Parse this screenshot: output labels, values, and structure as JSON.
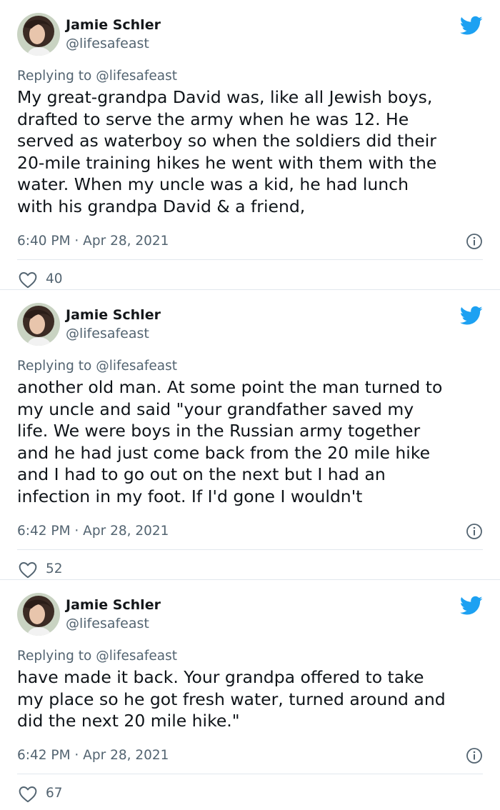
{
  "colors": {
    "brand": "#1da1f2",
    "secondary_text": "#536471",
    "divider": "#e1e8ed"
  },
  "tweets": [
    {
      "name": "Jamie Schler",
      "handle": "@lifesafeast",
      "replying_prefix": "Replying to ",
      "replying_to": "@lifesafeast",
      "text": "My great-grandpa David was, like all Jewish boys,\ndrafted to serve the army when he was 12. He\nserved as waterboy so when the soldiers did their\n20-mile training hikes he went with them with the\nwater. When my uncle was a kid, he had lunch\nwith his grandpa David & a friend,",
      "timestamp": "6:40 PM · Apr 28, 2021",
      "likes": "40"
    },
    {
      "name": "Jamie Schler",
      "handle": "@lifesafeast",
      "replying_prefix": "Replying to ",
      "replying_to": "@lifesafeast",
      "text": "another old man. At some point the man turned to\nmy uncle and said \"your grandfather saved my\nlife. We were boys in the Russian army together\nand he had just come back from the 20 mile hike\nand I had to go out on the next but I had an\ninfection in my foot. If I'd gone I wouldn't",
      "timestamp": "6:42 PM · Apr 28, 2021",
      "likes": "52"
    },
    {
      "name": "Jamie Schler",
      "handle": "@lifesafeast",
      "replying_prefix": "Replying to ",
      "replying_to": "@lifesafeast",
      "text": "have made it back. Your grandpa offered to take\nmy place so he got fresh water, turned around and\ndid the next 20 mile hike.\"",
      "timestamp": "6:42 PM · Apr 28, 2021",
      "likes": "67"
    }
  ],
  "icons": {
    "bird": "twitter-bird-icon",
    "info": "info-icon",
    "heart": "heart-outline-icon"
  }
}
